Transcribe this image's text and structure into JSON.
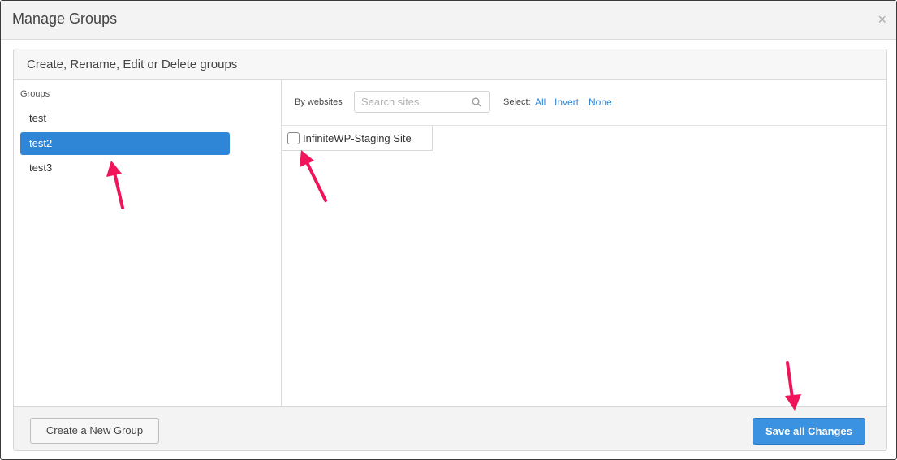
{
  "dialog": {
    "title": "Manage Groups",
    "close_glyph": "×"
  },
  "panel": {
    "heading": "Create, Rename, Edit or Delete groups"
  },
  "groups": {
    "label": "Groups",
    "items": [
      {
        "name": "test",
        "selected": false
      },
      {
        "name": "test2",
        "selected": true
      },
      {
        "name": "test3",
        "selected": false
      }
    ]
  },
  "sites": {
    "filter_label": "By websites",
    "search_placeholder": "Search sites",
    "select_label": "Select:",
    "select_links": [
      "All",
      "Invert",
      "None"
    ],
    "items": [
      {
        "name": "InfiniteWP-Staging Site",
        "checked": false
      }
    ]
  },
  "footer": {
    "create_label": "Create a New Group",
    "save_label": "Save all Changes"
  },
  "colors": {
    "accent": "#2f86d6",
    "annotation": "#f0155a"
  },
  "icons": [
    "close-icon",
    "search-icon",
    "annotation-arrow"
  ]
}
